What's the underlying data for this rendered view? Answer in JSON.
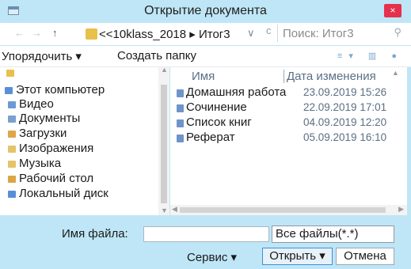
{
  "window": {
    "title": "Открытие документа",
    "close_label": "×"
  },
  "address": {
    "back_icon": "←",
    "forward_icon": "→",
    "up_icon": "↑",
    "path_text": "<<10klass_2018 ▸ Итог3",
    "dropdown_icon": "∨",
    "refresh_icon": "c",
    "search_placeholder": "Поиск: Итог3",
    "search_icon": "⚲"
  },
  "toolbar": {
    "organize_label": "Упорядочить ▾",
    "new_folder_label": "Создать папку",
    "view_icons": "≡▾ ▥ ●"
  },
  "nav": {
    "items": [
      {
        "label": "Этот компьютер",
        "icon": "computer-icon",
        "color": "#5a8fd8"
      },
      {
        "label": "Видео",
        "icon": "video-folder-icon",
        "color": "#6b9ad6"
      },
      {
        "label": "Документы",
        "icon": "documents-folder-icon",
        "color": "#7b9fcf"
      },
      {
        "label": "Загрузки",
        "icon": "downloads-folder-icon",
        "color": "#e0a54a"
      },
      {
        "label": "Изображения",
        "icon": "pictures-folder-icon",
        "color": "#e5c36a"
      },
      {
        "label": "Музыка",
        "icon": "music-folder-icon",
        "color": "#e5c36a"
      },
      {
        "label": "Рабочий стол",
        "icon": "desktop-folder-icon",
        "color": "#d9a748"
      },
      {
        "label": "Локальный диск",
        "icon": "disk-icon",
        "color": "#5a8fd8"
      }
    ]
  },
  "files": {
    "col_name": "Имя",
    "col_date": "Дата изменения",
    "rows": [
      {
        "name": "Домашняя работа",
        "date": "23.09.2019 15:26"
      },
      {
        "name": "Сочинение",
        "date": "22.09.2019 17:01"
      },
      {
        "name": "Список книг",
        "date": "04.09.2019 12:20"
      },
      {
        "name": "Реферат",
        "date": "05.09.2019 16:10"
      }
    ]
  },
  "bottom": {
    "filename_label": "Имя файла:",
    "filename_value": "",
    "filter_value": "Все файлы(*.*)",
    "tools_label": "Сервис ▾",
    "open_label": "Открыть ▾",
    "cancel_label": "Отмена"
  }
}
